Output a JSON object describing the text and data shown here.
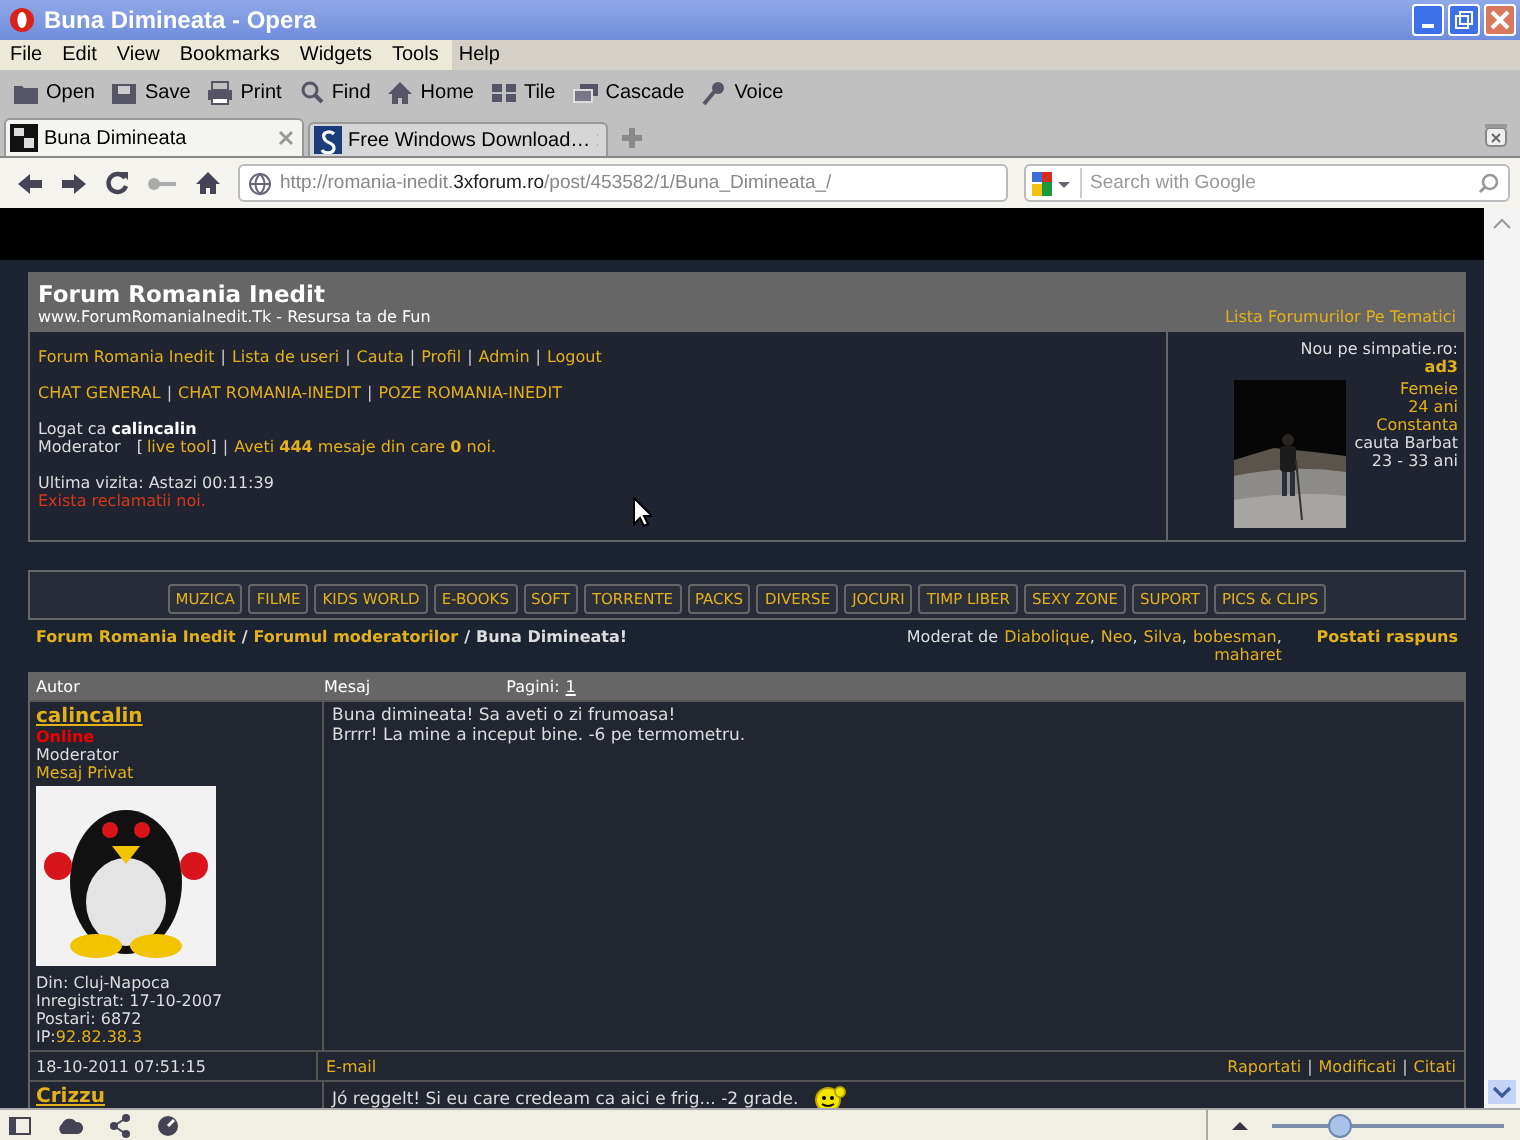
{
  "window": {
    "title": "Buna Dimineata - Opera"
  },
  "menu": [
    "File",
    "Edit",
    "View",
    "Bookmarks",
    "Widgets",
    "Tools",
    "Help"
  ],
  "toolbar": [
    {
      "label": "Open"
    },
    {
      "label": "Save"
    },
    {
      "label": "Print"
    },
    {
      "label": "Find"
    },
    {
      "label": "Home"
    },
    {
      "label": "Tile"
    },
    {
      "label": "Cascade"
    },
    {
      "label": "Voice"
    }
  ],
  "tabs": [
    {
      "label": "Buna Dimineata",
      "selected": true
    },
    {
      "label": "Free Windows Download…",
      "selected": false
    }
  ],
  "address": {
    "url": "http://romania-inedit.**3xforum.ro**/post/453582/1/Buna_Dimineata_/"
  },
  "search": {
    "placeholder": "Search with Google"
  },
  "separator": "|",
  "forum": {
    "title": "Forum Romania Inedit",
    "subtitle": "www.ForumRomaniaInedit.Tk - Resursa ta de Fun",
    "header_link": "Lista Forumurilor Pe Tematici",
    "links_row1": [
      "Forum Romania Inedit",
      "Lista de useri",
      "Cauta",
      "Profil",
      "Admin",
      "Logout"
    ],
    "links_row2": [
      "CHAT GENERAL",
      "CHAT ROMANIA-INEDIT",
      "POZE ROMANIA-INEDIT"
    ],
    "logged": "Logat ca **calincalin**",
    "role": "Moderator",
    "bracket_open": "[",
    "live_tool": "live tool",
    "bracket_close": "]",
    "messages": "Aveti **444** mesaje din care **0** noi.",
    "last_visit": "Ultima vizita: Astazi 00:11:39",
    "alert": "Exista reclamatii noi.",
    "promo": {
      "heading": "Nou pe simpatie.ro:",
      "user": "ad3",
      "details": [
        "Femeie",
        "24 ani",
        "Constanta"
      ],
      "seeking": [
        "cauta Barbat",
        "23 - 33 ani"
      ]
    }
  },
  "nav": [
    "MUZICA",
    "FILME",
    "KIDS WORLD",
    "E-BOOKS",
    "SOFT",
    "TORRENTE",
    "PACKS",
    "DIVERSE",
    "JOCURI",
    "TIMP LIBER",
    "SEXY ZONE",
    "SUPORT",
    "PICS & CLIPS"
  ],
  "breadcrumb": {
    "links": [
      "Forum Romania Inedit",
      "Forumul moderatorilor"
    ],
    "current": "Buna Dimineata!",
    "separator": "/"
  },
  "moderators": {
    "label": "Moderat de",
    "names": [
      "Diabolique",
      "Neo",
      "Silva",
      "bobesman",
      "maharet"
    ],
    "separator": ","
  },
  "reply": "Postati raspuns",
  "table": {
    "columns": [
      "Autor",
      "Mesaj"
    ],
    "pages_label": "Pagini:",
    "page": "1"
  },
  "posts": [
    {
      "author": "calincalin",
      "status": "Online",
      "rank": "Moderator",
      "pm": "Mesaj Privat",
      "avatar": {
        "kind": "picture"
      },
      "info": [
        "Din: Cluj-Napoca",
        "Inregistrat: 17-10-2007",
        "Postari: 6872"
      ],
      "ip_label": "IP:",
      "ip": "92.82.38.3",
      "lines": [
        "Buna dimineata! Sa aveti o zi frumoasa!",
        "Brrrr! La mine a inceput bine. -6 pe termometru."
      ],
      "date": "18-10-2011 07:51:15",
      "email": "E-mail",
      "actions": [
        "Raportati",
        "Modificati",
        "Citati"
      ]
    },
    {
      "author": "Crizzu",
      "lines": [
        "Jó reggelt! Si eu care credeam ca aici e frig... -2 grade."
      ]
    }
  ],
  "status_bar": {
    "zoom": {
      "level": 0.29
    }
  }
}
